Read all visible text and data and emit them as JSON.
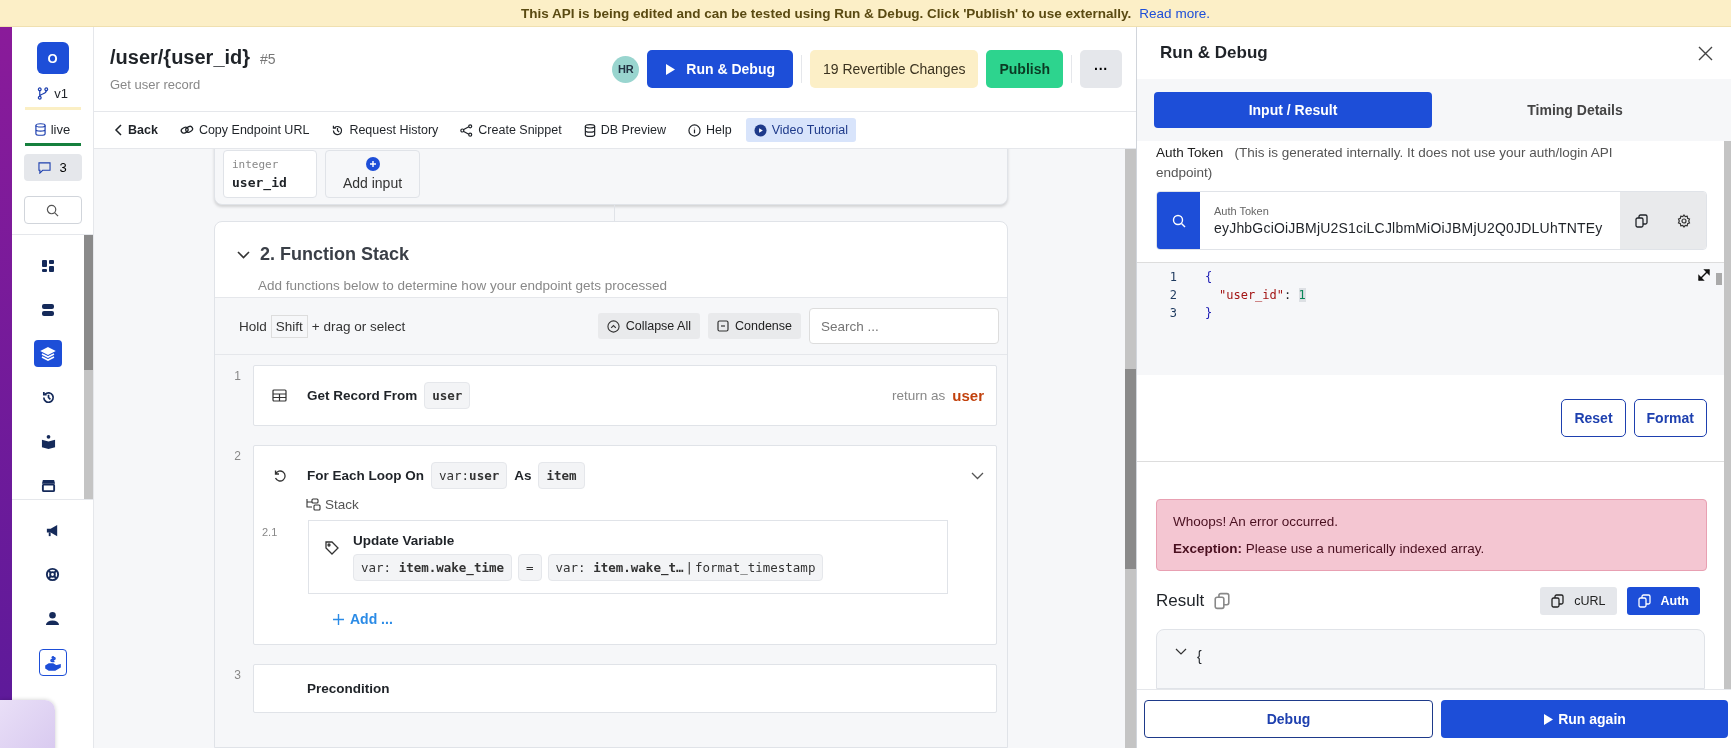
{
  "banner": {
    "text": "This API is being edited and can be tested using Run & Debug. Click 'Publish' to use externally.",
    "link": "Read more."
  },
  "sidebar": {
    "workspace": "O",
    "branch": "v1",
    "environment": "live",
    "comments": "3",
    "nav": [
      {
        "kind": "dashboard",
        "selected": false,
        "outlined": false
      },
      {
        "kind": "database",
        "selected": false,
        "outlined": false
      },
      {
        "kind": "layers",
        "selected": true,
        "outlined": false
      },
      {
        "kind": "history",
        "selected": false,
        "outlined": false
      },
      {
        "kind": "book",
        "selected": false,
        "outlined": false
      },
      {
        "kind": "store",
        "selected": false,
        "outlined": false
      }
    ],
    "nav_bottom": [
      {
        "kind": "megaphone",
        "selected": false,
        "outlined": false
      },
      {
        "kind": "lifebuoy",
        "selected": false,
        "outlined": false
      },
      {
        "kind": "user",
        "selected": false,
        "outlined": false
      },
      {
        "kind": "hand",
        "selected": false,
        "outlined": true
      }
    ]
  },
  "header": {
    "title": "/user/{user_id}",
    "number": "#5",
    "subtitle": "Get user record",
    "avatar": "HR",
    "run_button": "Run & Debug",
    "changes": "19 Revertible Changes",
    "publish": "Publish",
    "more": "···"
  },
  "toolbar": [
    {
      "kind": "back",
      "label": "Back",
      "selected": false
    },
    {
      "kind": "link",
      "label": "Copy Endpoint URL",
      "selected": false
    },
    {
      "kind": "history",
      "label": "Request History",
      "selected": false
    },
    {
      "kind": "share",
      "label": "Create Snippet",
      "selected": false
    },
    {
      "kind": "database",
      "label": "DB Preview",
      "selected": false
    },
    {
      "kind": "info",
      "label": "Help",
      "selected": false
    },
    {
      "kind": "play",
      "label": "Video Tutorial",
      "selected": true
    }
  ],
  "inputs": {
    "items": [
      {
        "type": "integer",
        "name": "user_id"
      }
    ],
    "add_button": "Add input"
  },
  "function_stack": {
    "title": "2. Function Stack",
    "expanded": true,
    "description": "Add functions below to determine how your endpoint gets processed",
    "hint_before": "Hold",
    "hint_key": "Shift",
    "hint_after": "+ drag or select",
    "collapse_all": "Collapse All",
    "condense": "Condense",
    "search_placeholder": "Search ...",
    "steps": [
      {
        "number": "1",
        "kind": "get_record",
        "title": "Get Record From",
        "tokens": [
          {
            "value": "user"
          }
        ],
        "return_label": "return as",
        "return_var": "user"
      },
      {
        "number": "2",
        "kind": "loop",
        "title": "For Each Loop On",
        "tokens": [
          {
            "prefix": "var:",
            "value": "user"
          }
        ],
        "as": "As",
        "alias": "item",
        "stack_label": "Stack",
        "expanded": true,
        "add_label": "Add ...",
        "children": [
          {
            "number": "2.1",
            "title": "Update Variable",
            "target": {
              "prefix": "var:",
              "value": "item.wake_time"
            },
            "operator": "=",
            "source": {
              "prefix": "var:",
              "value": "item.wake_t…",
              "pipe": "|",
              "filter": "format_timestamp"
            }
          }
        ]
      },
      {
        "number": "3",
        "kind": "precondition",
        "title": "Precondition"
      }
    ]
  },
  "panel": {
    "title": "Run & Debug",
    "tabs": [
      {
        "label": "Input / Result",
        "selected": true
      },
      {
        "label": "Timing Details",
        "selected": false
      }
    ],
    "auth_label": "Auth Token",
    "auth_note": "(This is generated internally. It does not use your auth/login API endpoint)",
    "token_label": "Auth Token",
    "token_value": "eyJhbGciOiJBMjU2S1ciLCJlbmMiOiJBMjU2Q0JDLUhTNTEy",
    "editor_lines": [
      {
        "number": "1",
        "tokens": [
          {
            "kind": "brace",
            "text": "{"
          }
        ]
      },
      {
        "number": "2",
        "tokens": [
          {
            "kind": "key",
            "text": "\"user_id\""
          },
          {
            "kind": "punct",
            "text": ":"
          },
          {
            "kind": "number",
            "text": "1"
          }
        ]
      },
      {
        "number": "3",
        "tokens": [
          {
            "kind": "brace",
            "text": "}"
          }
        ]
      }
    ],
    "reset": "Reset",
    "format": "Format",
    "error_title": "Whoops! An error occurred.",
    "error_message": "**Exception:** Please use a numerically indexed array.",
    "result_label": "Result",
    "curl": "cURL",
    "auth": "Auth",
    "result_line": "{",
    "debug": "Debug",
    "run_again": "Run again"
  }
}
